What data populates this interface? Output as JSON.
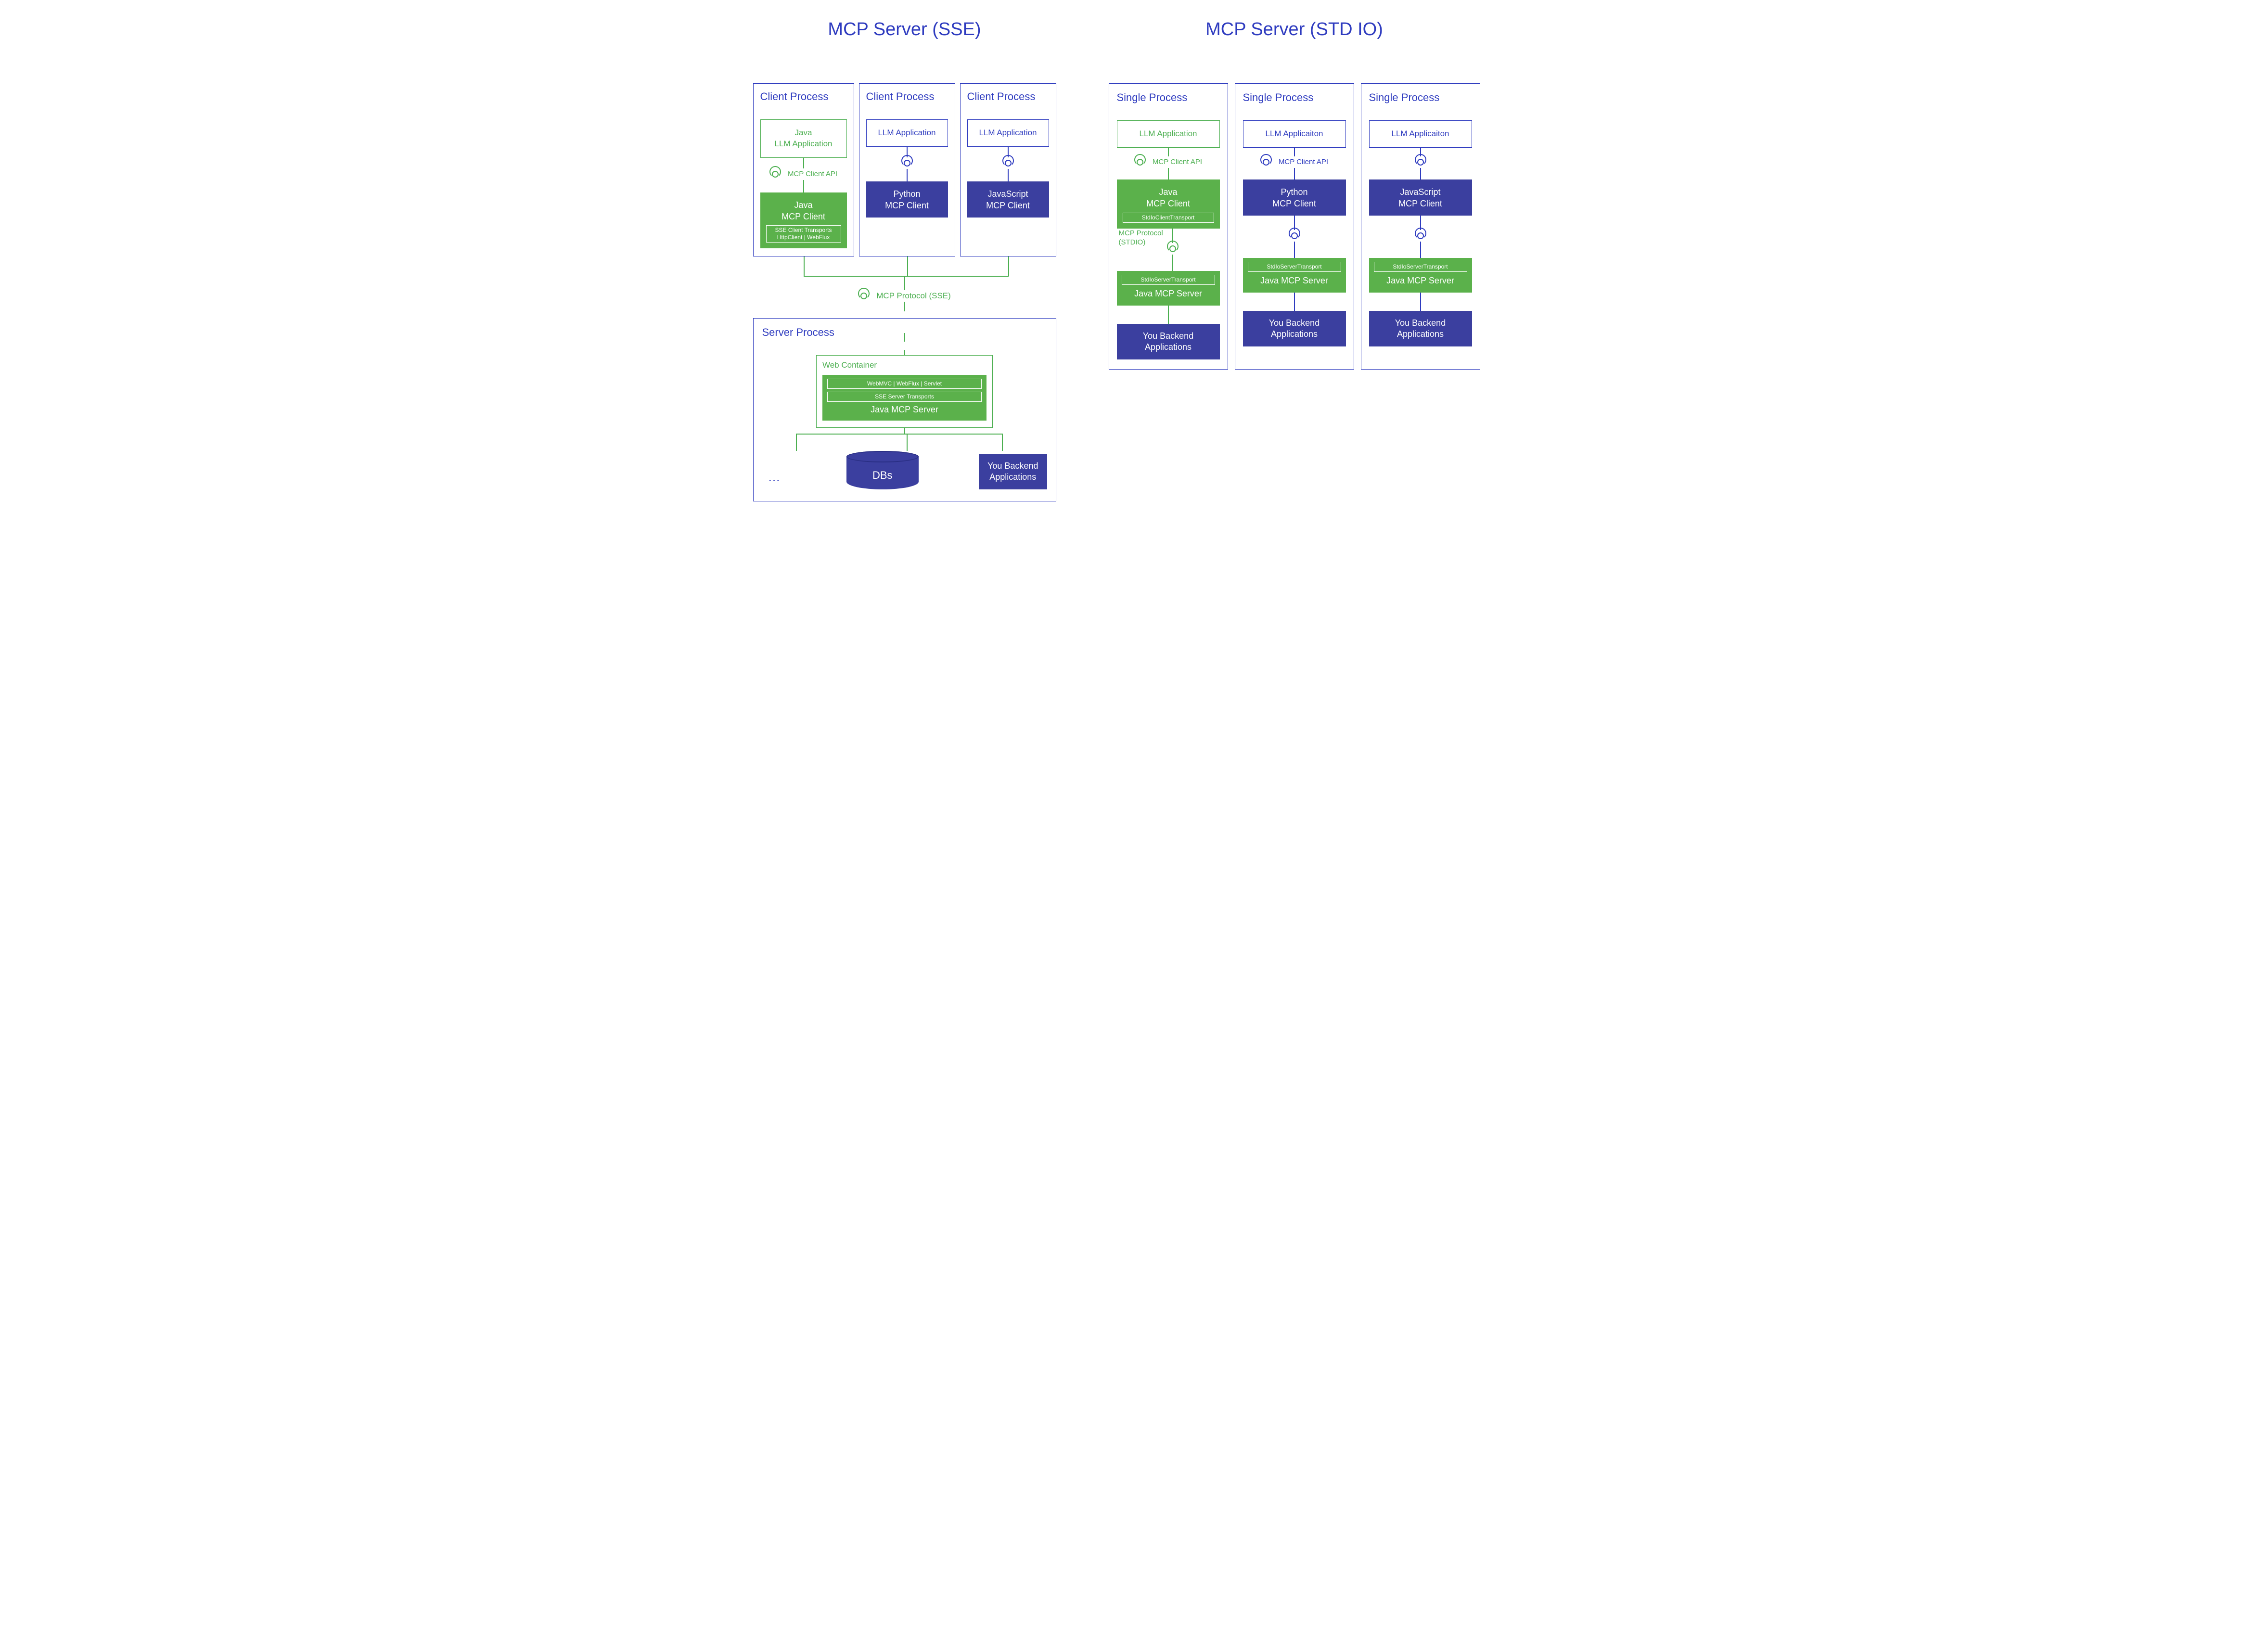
{
  "left": {
    "title": "MCP Server (SSE)",
    "clients": [
      {
        "process_title": "Client Process",
        "app_line1": "Java",
        "app_line2": "LLM Application",
        "api_label": "MCP Client API",
        "client_line1": "Java",
        "client_line2": "MCP Client",
        "transport_title": "SSE Client Transports",
        "transport_sub": "HttpClient | WebFlux",
        "green": true
      },
      {
        "process_title": "Client Process",
        "app_line1": "",
        "app_line2": "LLM Application",
        "api_label": "",
        "client_line1": "Python",
        "client_line2": "MCP Client",
        "green": false
      },
      {
        "process_title": "Client Process",
        "app_line1": "",
        "app_line2": "LLM Application",
        "api_label": "",
        "client_line1": "JavaScript",
        "client_line2": "MCP Client",
        "green": false
      }
    ],
    "protocol_label": "MCP Protocol (SSE)",
    "server": {
      "process_title": "Server Process",
      "web_container_title": "Web Container",
      "server_transport_top": "WebMVC | WebFlux | Servlet",
      "server_transport_title": "SSE Server Transports",
      "server_name": "Java MCP Server",
      "ellipsis": "…",
      "db_label": "DBs",
      "backend_line1": "You Backend",
      "backend_line2": "Applications"
    }
  },
  "right": {
    "title": "MCP Server (STD IO)",
    "columns": [
      {
        "process_title": "Single Process",
        "app": "LLM Application",
        "api_label": "MCP Client API",
        "client_line1": "Java",
        "client_line2": "MCP Client",
        "client_transport": "StdIoClientTransport",
        "proto_line1": "MCP Protocol",
        "proto_line2": "(STDIO)",
        "server_transport": "StdIoServerTransport",
        "server_name": "Java MCP Server",
        "backend_line1": "You Backend",
        "backend_line2": "Applications",
        "green": true
      },
      {
        "process_title": "Single Process",
        "app": "LLM Applicaiton",
        "api_label": "MCP Client API",
        "client_line1": "Python",
        "client_line2": "MCP Client",
        "client_transport": "",
        "proto_line1": "",
        "proto_line2": "",
        "server_transport": "StdIoServerTransport",
        "server_name": "Java MCP Server",
        "backend_line1": "You Backend",
        "backend_line2": "Applications",
        "green": false
      },
      {
        "process_title": "Single Process",
        "app": "LLM Applicaiton",
        "api_label": "",
        "client_line1": "JavaScript",
        "client_line2": "MCP Client",
        "client_transport": "",
        "proto_line1": "",
        "proto_line2": "",
        "server_transport": "StdIoServerTransport",
        "server_name": "Java MCP Server",
        "backend_line1": "You Backend",
        "backend_line2": "Applications",
        "green": false
      }
    ]
  }
}
